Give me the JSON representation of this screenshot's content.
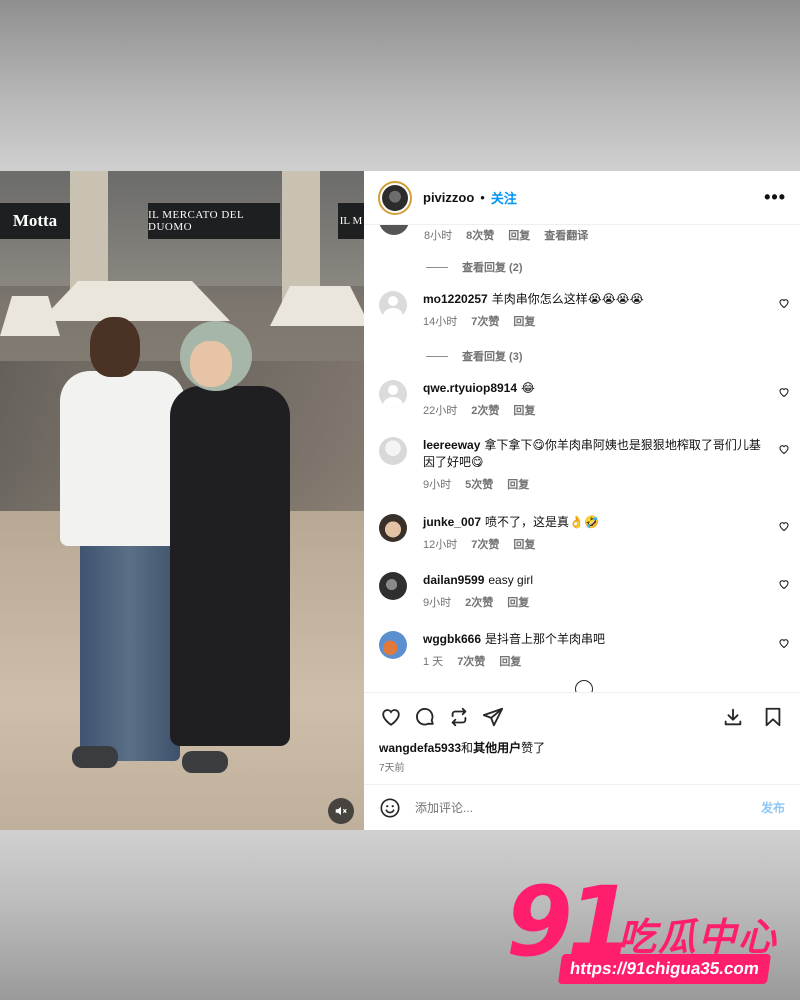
{
  "post": {
    "username": "pivizzoo",
    "separator": "•",
    "follow_label": "关注",
    "more_label": "•••"
  },
  "comments_area": {
    "top_meta": {
      "time": "8小时",
      "likes": "8次赞",
      "reply": "回复",
      "translate": "查看翻译"
    },
    "view_replies_1": "查看回复 (2)",
    "view_replies_2": "查看回复 (3)",
    "items": [
      {
        "user": "mo1220257",
        "text": "羊肉串你怎么这样😭😭😭😭",
        "time": "14小时",
        "likes": "7次赞",
        "reply": "回复"
      },
      {
        "user": "qwe.rtyuiop8914",
        "text": "😂",
        "time": "22小时",
        "likes": "2次赞",
        "reply": "回复"
      },
      {
        "user": "leereeway",
        "text": "拿下拿下😋你羊肉串阿姨也是狠狠地榨取了哥们儿基因了好吧😋",
        "time": "9小时",
        "likes": "5次赞",
        "reply": "回复"
      },
      {
        "user": "junke_007",
        "text": "喷不了，这是真👌🤣",
        "time": "12小时",
        "likes": "7次赞",
        "reply": "回复"
      },
      {
        "user": "dailan9599",
        "text": "easy girl",
        "time": "9小时",
        "likes": "2次赞",
        "reply": "回复"
      },
      {
        "user": "wggbk666",
        "text": "是抖音上那个羊肉串吧",
        "time": "1 天",
        "likes": "7次赞",
        "reply": "回复"
      }
    ]
  },
  "likes": {
    "user": "wangdefa5933",
    "and": "和",
    "others": "其他用户",
    "suffix": "赞了"
  },
  "posted_ago": "7天前",
  "add_comment": {
    "placeholder": "添加评论...",
    "post_label": "发布"
  },
  "video": {
    "sign_left": "Motta",
    "sign_center": "IL MERCATO DEL DUOMO",
    "sign_right": "IL M"
  },
  "watermark": {
    "number": "91",
    "name": "吃瓜中心",
    "url": "https://91chigua35.com"
  },
  "colors": {
    "follow_blue": "#0095f6",
    "post_blue_disabled": "#8ec7f5",
    "watermark_pink": "#ff1e6e"
  }
}
